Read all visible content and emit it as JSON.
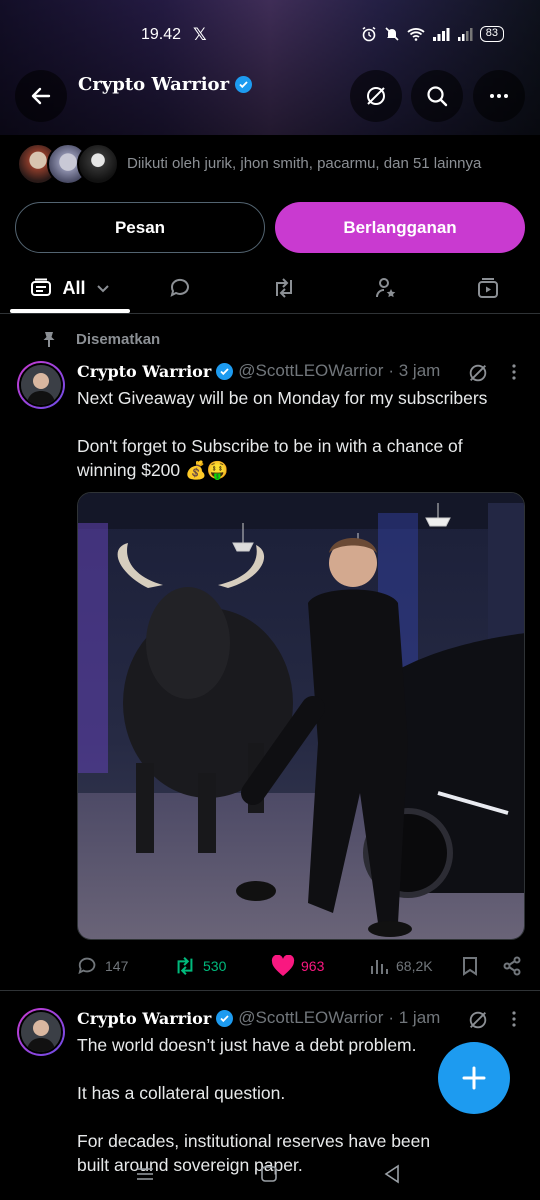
{
  "status_bar": {
    "time": "19.42",
    "x_logo": "𝕏",
    "battery": "83"
  },
  "profile": {
    "name": "Crypto Warrior",
    "followed_by": "Diikuti oleh jurik, jhon smith, pacarmu, dan 51 lainnya"
  },
  "buttons": {
    "message": "Pesan",
    "subscribe": "Berlangganan"
  },
  "tabs": {
    "all_label": "All"
  },
  "pinned_label": "Disematkan",
  "posts": [
    {
      "name": "Crypto Warrior",
      "handle": "@ScottLEOWarrior",
      "time": "· 3 jam",
      "text": "Next Giveaway will be on Monday for my subscribers\n\nDon't forget to Subscribe to be in with a chance of winning $200 💰🤑",
      "replies": "147",
      "reposts": "530",
      "likes": "963",
      "views": "68,2K"
    },
    {
      "name": "Crypto Warrior",
      "handle": "@ScottLEOWarrior",
      "time": "· 1 jam",
      "text": "The world doesn’t just have a debt problem.\n\nIt has a collateral question.\n\nFor decades, institutional reserves have been built around sovereign paper."
    }
  ],
  "colors": {
    "accent": "#c93ad0",
    "verified": "#1d9bf0",
    "repost_green": "#00ba7c",
    "like_pink": "#f91880"
  }
}
